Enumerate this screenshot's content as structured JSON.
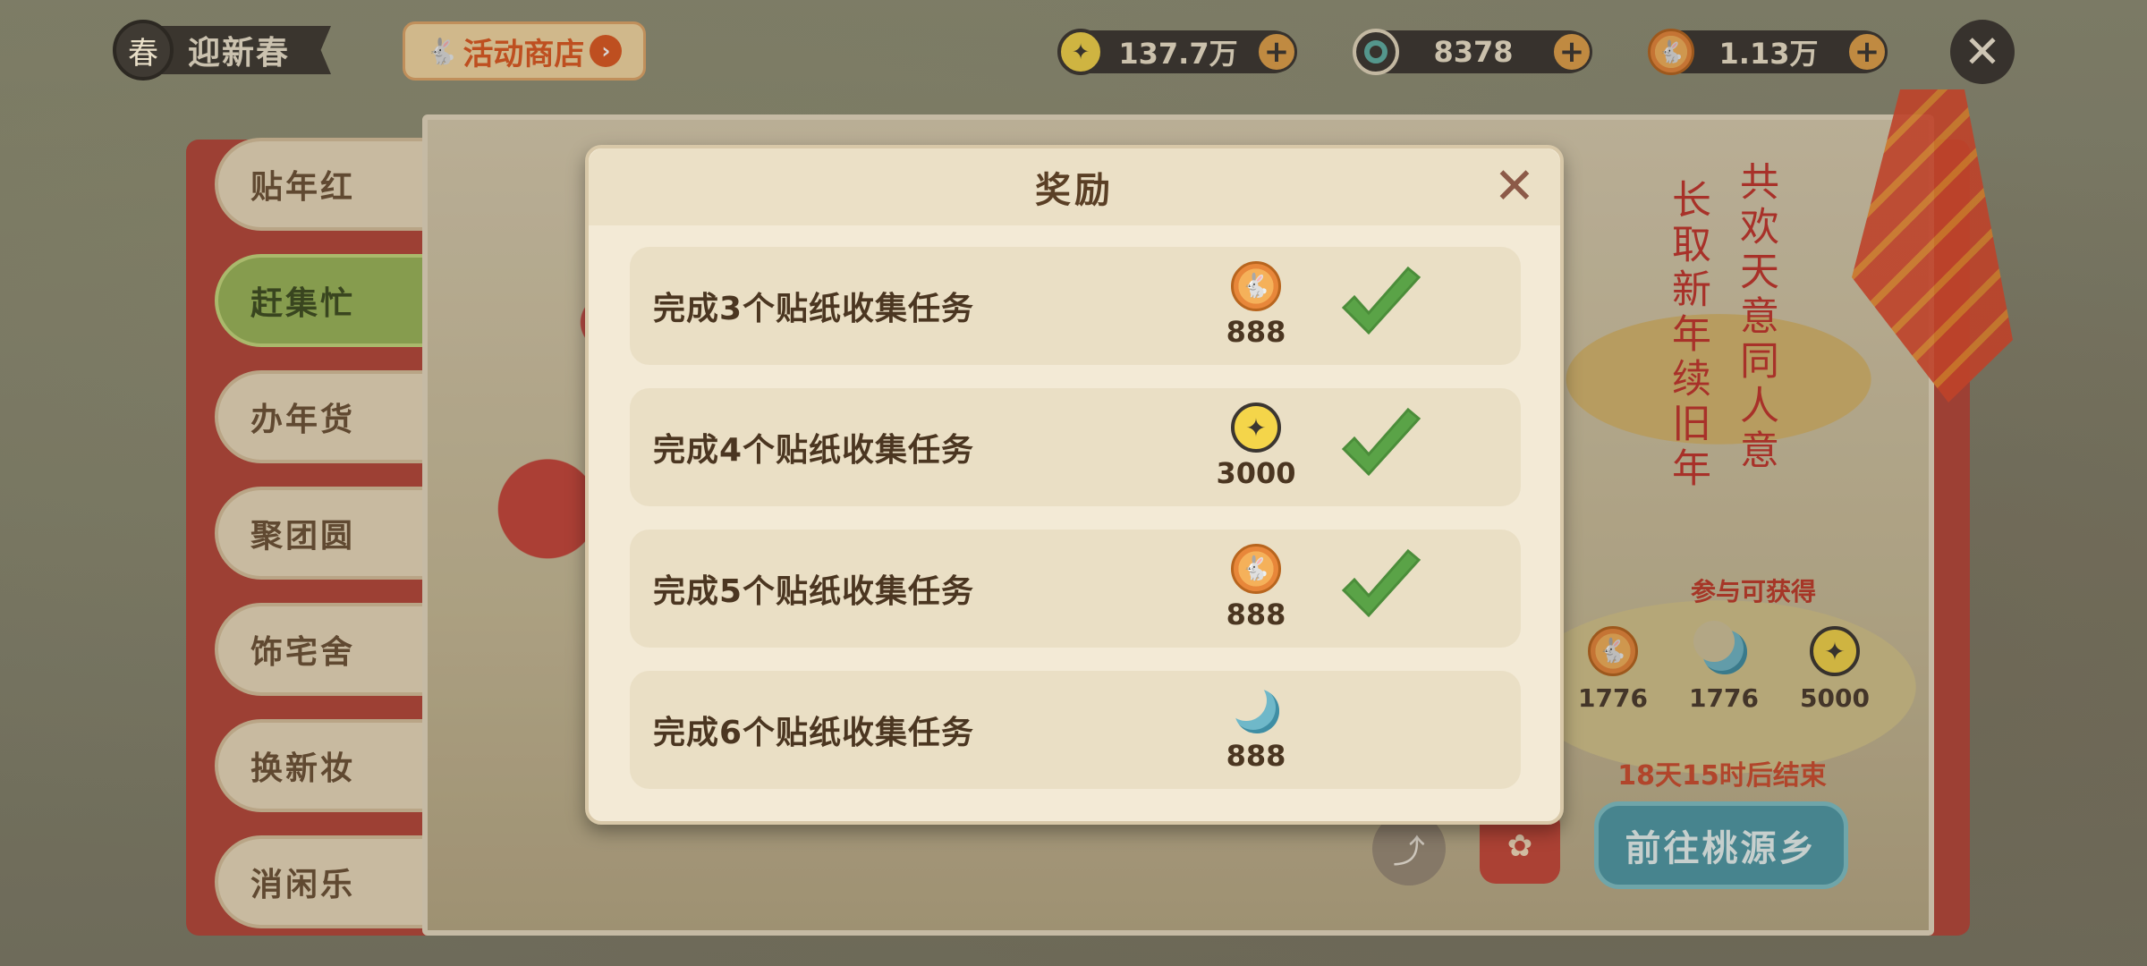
{
  "header": {
    "seal_char": "春",
    "event_title": "迎新春",
    "shop_label": "活动商店",
    "close_label": "✕"
  },
  "currencies": [
    {
      "name": "coin",
      "icon": "star-coin-icon",
      "value": "137.7万"
    },
    {
      "name": "jade",
      "icon": "jade-ring-icon",
      "value": "8378"
    },
    {
      "name": "rabbit",
      "icon": "rabbit-coin-icon",
      "value": "1.13万"
    }
  ],
  "tabs": [
    {
      "label": "贴年红",
      "active": false
    },
    {
      "label": "赶集忙",
      "active": true
    },
    {
      "label": "办年货",
      "active": false
    },
    {
      "label": "聚团圆",
      "active": false
    },
    {
      "label": "饰宅舍",
      "active": false
    },
    {
      "label": "换新妆",
      "active": false
    },
    {
      "label": "消闲乐",
      "active": false
    }
  ],
  "poem": {
    "right_col": "共欢天意同人意",
    "left_col": "长取新年续旧年"
  },
  "participation": {
    "hint": "参与可获得",
    "items": [
      {
        "icon": "rabbit-coin-icon",
        "amount": "1776"
      },
      {
        "icon": "moon-icon",
        "amount": "1776"
      },
      {
        "icon": "star-coin-icon",
        "amount": "5000"
      }
    ],
    "countdown": "18天15时后结束",
    "go_button": "前往桃源乡"
  },
  "modal": {
    "title": "奖励",
    "close_label": "✕",
    "tasks": [
      {
        "label": "完成3个贴纸收集任务",
        "reward_icon": "rabbit-coin-icon",
        "amount": "888",
        "claimed": true
      },
      {
        "label": "完成4个贴纸收集任务",
        "reward_icon": "star-coin-icon",
        "amount": "3000",
        "claimed": true
      },
      {
        "label": "完成5个贴纸收集任务",
        "reward_icon": "rabbit-coin-icon",
        "amount": "888",
        "claimed": true
      },
      {
        "label": "完成6个贴纸收集任务",
        "reward_icon": "moon-icon",
        "amount": "888",
        "claimed": false
      }
    ]
  },
  "colors": {
    "accent_red": "#c5352c",
    "check_green": "#5aa347",
    "tab_active": "#9bb85a",
    "button_teal": "#4f9aa8"
  }
}
